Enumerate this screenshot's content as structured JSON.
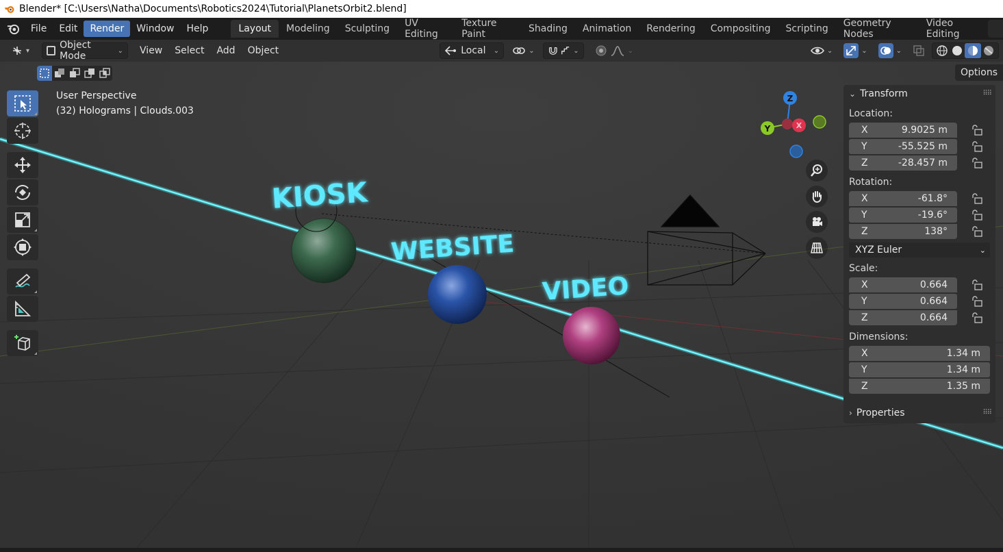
{
  "window": {
    "title": "Blender* [C:\\Users\\Natha\\Documents\\Robotics2024\\Tutorial\\PlanetsOrbit2.blend]"
  },
  "menubar": {
    "items": [
      "File",
      "Edit",
      "Render",
      "Window",
      "Help"
    ],
    "active": "Render"
  },
  "workspaces": {
    "tabs": [
      "Layout",
      "Modeling",
      "Sculpting",
      "UV Editing",
      "Texture Paint",
      "Shading",
      "Animation",
      "Rendering",
      "Compositing",
      "Scripting",
      "Geometry Nodes",
      "Video Editing"
    ],
    "active": "Layout",
    "add": "+"
  },
  "header": {
    "mode": "Object Mode",
    "menus": [
      "View",
      "Select",
      "Add",
      "Object"
    ],
    "orientation": "Local",
    "options_label": "Options"
  },
  "viewport": {
    "perspective": "User Perspective",
    "context": "(32) Holograms | Clouds.003",
    "labels": [
      "KIOSK",
      "WEBSITE",
      "VIDEO"
    ],
    "gizmo_axes": {
      "z": "Z",
      "y": "Y",
      "x": "X"
    },
    "colors": {
      "background": "#3a3a3a",
      "beam": "#4ef3ff",
      "label_glow": "#5ee9ff",
      "axis_x": "#e0334f",
      "axis_y": "#8bc926",
      "axis_z": "#2f83e3",
      "accent": "#4772b3"
    }
  },
  "npanel": {
    "transform_title": "Transform",
    "location_label": "Location:",
    "location": [
      {
        "axis": "X",
        "value": "9.9025 m"
      },
      {
        "axis": "Y",
        "value": "-55.525 m"
      },
      {
        "axis": "Z",
        "value": "-28.457 m"
      }
    ],
    "rotation_label": "Rotation:",
    "rotation": [
      {
        "axis": "X",
        "value": "-61.8°"
      },
      {
        "axis": "Y",
        "value": "-19.6°"
      },
      {
        "axis": "Z",
        "value": "138°"
      }
    ],
    "rotation_mode": "XYZ Euler",
    "scale_label": "Scale:",
    "scale": [
      {
        "axis": "X",
        "value": "0.664"
      },
      {
        "axis": "Y",
        "value": "0.664"
      },
      {
        "axis": "Z",
        "value": "0.664"
      }
    ],
    "dimensions_label": "Dimensions:",
    "dimensions": [
      {
        "axis": "X",
        "value": "1.34 m"
      },
      {
        "axis": "Y",
        "value": "1.34 m"
      },
      {
        "axis": "Z",
        "value": "1.35 m"
      }
    ],
    "properties_title": "Properties"
  }
}
